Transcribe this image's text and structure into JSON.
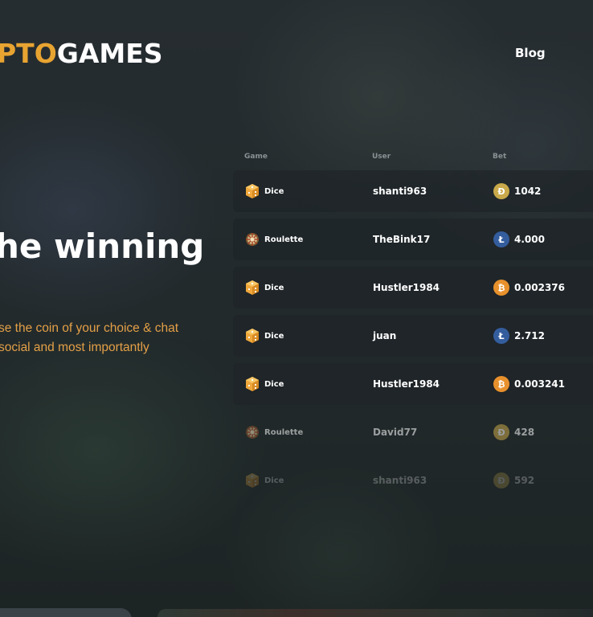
{
  "brand": {
    "logo_accent": "PTO",
    "logo_main": "GAMES"
  },
  "nav": {
    "blog": "Blog"
  },
  "hero": {
    "headline": "he winning",
    "subline_1": "se the coin of your choice & chat",
    "subline_2": "social and most importantly"
  },
  "bets_table": {
    "headers": {
      "game": "Game",
      "user": "User",
      "bet": "Bet"
    },
    "rows": [
      {
        "game": "Dice",
        "game_icon": "dice-icon",
        "user": "shanti963",
        "coin_icon": "dogecoin-icon",
        "bet": "1042"
      },
      {
        "game": "Roulette",
        "game_icon": "roulette-icon",
        "user": "TheBink17",
        "coin_icon": "litecoin-icon",
        "bet": "4.000"
      },
      {
        "game": "Dice",
        "game_icon": "dice-icon",
        "user": "Hustler1984",
        "coin_icon": "bitcoin-icon",
        "bet": "0.002376"
      },
      {
        "game": "Dice",
        "game_icon": "dice-icon",
        "user": "juan",
        "coin_icon": "litecoin-icon",
        "bet": "2.712"
      },
      {
        "game": "Dice",
        "game_icon": "dice-icon",
        "user": "Hustler1984",
        "coin_icon": "bitcoin-icon",
        "bet": "0.003241"
      },
      {
        "game": "Roulette",
        "game_icon": "roulette-icon",
        "user": "David77",
        "coin_icon": "dogecoin-icon",
        "bet": "428"
      },
      {
        "game": "Dice",
        "game_icon": "dice-icon",
        "user": "shanti963",
        "coin_icon": "dogecoin-icon",
        "bet": "592"
      }
    ]
  },
  "colors": {
    "accent": "#e8a431",
    "dogecoin": "#c9a94a",
    "litecoin": "#345d9d",
    "bitcoin": "#e8912c",
    "dice": "#f0a73b"
  }
}
